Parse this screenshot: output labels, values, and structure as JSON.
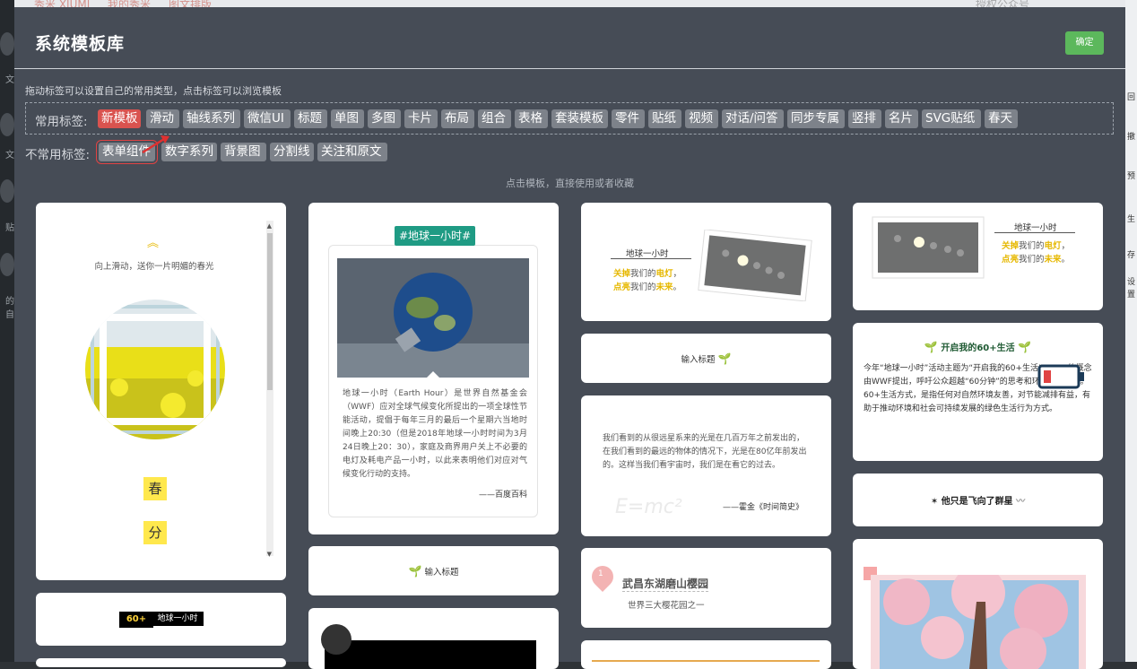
{
  "underlay": {
    "breadcrumb": [
      "秀米 XIUMI",
      "我的秀米",
      "图文排版"
    ],
    "left_rail_labels": [
      "文",
      "文",
      "贴",
      "的自"
    ],
    "right_rail_labels": [
      "回",
      "撤",
      "预",
      "生",
      "存",
      "设",
      "置"
    ],
    "top_right_text": "授权公众号"
  },
  "modal": {
    "title": "系统模板库",
    "confirm_label": "确定",
    "drag_hint": "拖动标签可以设置自己的常用类型，点击标签可以浏览模板",
    "common_label": "常用标签:",
    "uncommon_label": "不常用标签:",
    "common_tags": [
      "新模板",
      "滑动",
      "轴线系列",
      "微信UI",
      "标题",
      "单图",
      "多图",
      "卡片",
      "布局",
      "组合",
      "表格",
      "套装模板",
      "零件",
      "贴纸",
      "视频",
      "对话/问答",
      "同步专属",
      "竖排",
      "名片",
      "SVG贴纸",
      "春天"
    ],
    "uncommon_tags": [
      "表单组件",
      "数字系列",
      "背景图",
      "分割线",
      "关注和原文"
    ],
    "active_tag": "新模板",
    "highlighted_tag": "表单组件",
    "center_hint": "点击模板，直接使用或者收藏",
    "colors": {
      "modal_bg": "#464c56",
      "confirm": "#5cb85c",
      "active_tag": "#d9534f",
      "tag_bg": "#7d828a"
    }
  },
  "templates": {
    "slide_card": {
      "title": "向上滑动，送你一片明媚的春光",
      "chars": [
        "春",
        "分"
      ]
    },
    "earth_card": {
      "banner": "#地球一小时#",
      "body": "地球一小时（Earth Hour）是世界自然基金会（WWF）应对全球气候变化所提出的一项全球性节能活动，提倡于每年三月的最后一个星期六当地时间晚上20:30（但是2018年地球一小时时间为3月24日晚上20：30），家庭及商界用户关上不必要的电灯及耗电产品一小时，以此来表明他们对应对气候变化行动的支持。",
      "source": "——百度百科"
    },
    "earth_hour_small": {
      "title": "地球一小时",
      "line1_a": "关掉",
      "line1_b": "我们的",
      "line1_c": "电灯",
      "line1_d": "，",
      "line2_a": "点亮",
      "line2_b": "我们的",
      "line2_c": "未来",
      "line2_d": "。"
    },
    "input_title": "输入标题",
    "hawking_card": {
      "body": "我们看到的从很远星系来的光是在几百万年之前发出的，在我们看到的最远的物体的情况下，光是在80亿年前发出的。这样当我们看宇宙时，我们是在看它的过去。",
      "source": "——霍金《时间简史》",
      "formula": "E=mc²"
    },
    "wuchang_card": {
      "number": "1",
      "title": "武昌东湖磨山樱园",
      "subtitle": "世界三大樱花园之一"
    },
    "sixty_card": {
      "title": "开启我的60+生活",
      "body": "今年“地球一小时”活动主题为“开启我的60+生活”。60+的概念由WWF提出，呼吁公众超越“60分钟”的思考和环保行动转变。60+生活方式，是指任何对自然环境友善，对节能减排有益，有助于推动环境和社会可持续发展的绿色生活行为方式。"
    },
    "fly_card": {
      "title": "他只是飞向了群星"
    },
    "badge_card": {
      "left": "60+",
      "right": "地球一小时"
    }
  }
}
